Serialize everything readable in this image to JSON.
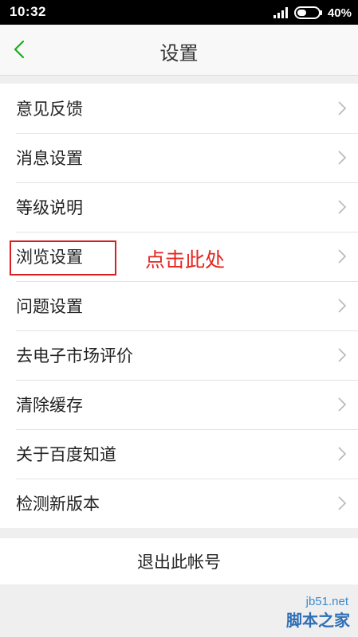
{
  "statusbar": {
    "time": "10:32",
    "battery": "40%"
  },
  "navbar": {
    "title": "设置",
    "back_icon": "chevron-left-icon"
  },
  "menu": {
    "items": [
      {
        "label": "意见反馈"
      },
      {
        "label": "消息设置"
      },
      {
        "label": "等级说明"
      },
      {
        "label": "浏览设置"
      },
      {
        "label": "问题设置"
      },
      {
        "label": "去电子市场评价"
      },
      {
        "label": "清除缓存"
      },
      {
        "label": "关于百度知道"
      },
      {
        "label": "检测新版本"
      }
    ]
  },
  "annotation": {
    "text": "点击此处",
    "color": "#e52621"
  },
  "logout": {
    "label": "退出此帐号"
  },
  "watermark": {
    "url": "jb51.net",
    "name": "脚本之家"
  },
  "colors": {
    "accent": "#1aad19",
    "highlight": "#d81e1e"
  }
}
